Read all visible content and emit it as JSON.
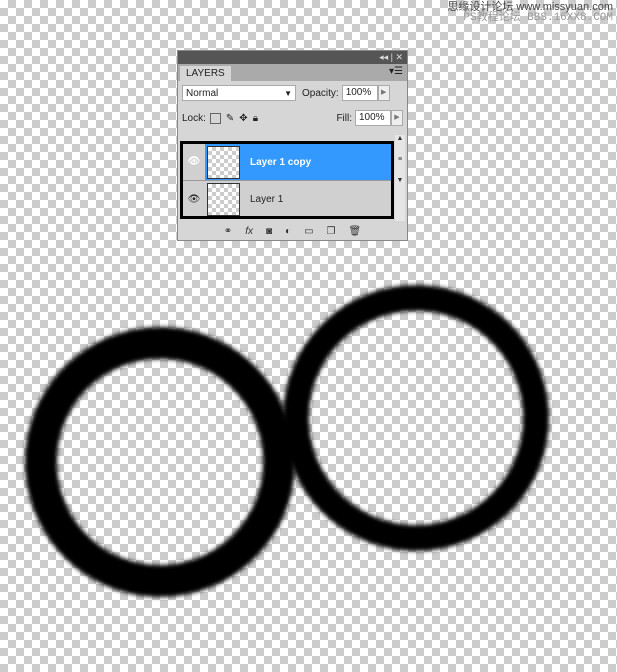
{
  "watermark": {
    "line1": "思缘设计论坛 www.missyuan.com",
    "line2": "PS教程论坛 BBS.16XX8.COM"
  },
  "panel": {
    "title_controls": "◂◂ | ✕",
    "tab": "LAYERS",
    "blend_mode": "Normal",
    "opacity_label": "Opacity:",
    "opacity": "100%",
    "lock_label": "Lock:",
    "fill_label": "Fill:",
    "fill": "100%",
    "layers": [
      {
        "name": "Layer 1 copy",
        "selected": true,
        "visible": true
      },
      {
        "name": "Layer 1",
        "selected": false,
        "visible": true
      }
    ],
    "bottom_icons": [
      "link-icon",
      "fx-icon",
      "mask-icon",
      "adjustment-icon",
      "folder-icon",
      "new-layer-icon",
      "trash-icon"
    ]
  },
  "colors": {
    "selection": "#3399ff",
    "ring": "#000000"
  }
}
